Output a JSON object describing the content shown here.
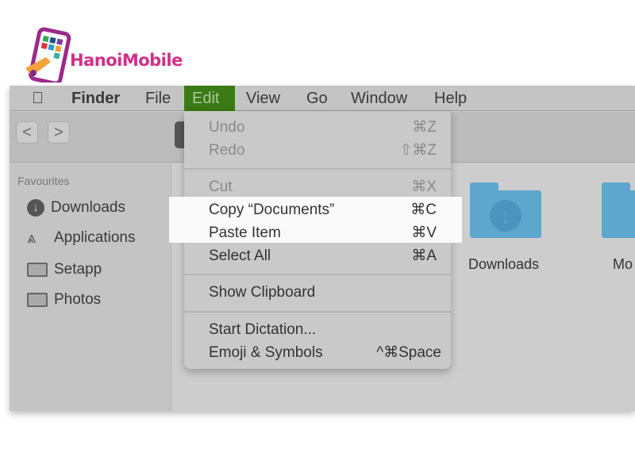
{
  "logo": {
    "text": "HanoiMobile"
  },
  "menubar": {
    "apple": "",
    "items": [
      "Finder",
      "File",
      "Edit",
      "View",
      "Go",
      "Window",
      "Help"
    ],
    "active": "Edit",
    "active_color": "#3b7a14"
  },
  "sidebar": {
    "heading": "Favourites",
    "items": [
      {
        "label": "Downloads",
        "icon": "download-circle-icon"
      },
      {
        "label": "Applications",
        "icon": "applications-icon"
      },
      {
        "label": "Setapp",
        "icon": "folder-icon"
      },
      {
        "label": "Photos",
        "icon": "folder-icon"
      }
    ]
  },
  "toolbar": {
    "back": "<",
    "forward": ">"
  },
  "edit_menu": {
    "items": [
      {
        "label": "Undo",
        "shortcut": "⌘Z",
        "enabled": false
      },
      {
        "label": "Redo",
        "shortcut": "⇧⌘Z",
        "enabled": false
      },
      {
        "label": "Cut",
        "shortcut": "⌘X",
        "enabled": false
      },
      {
        "label": "Copy “Documents”",
        "shortcut": "⌘C",
        "enabled": true,
        "highlighted": true
      },
      {
        "label": "Paste Item",
        "shortcut": "⌘V",
        "enabled": true,
        "highlighted": true
      },
      {
        "label": "Select All",
        "shortcut": "⌘A",
        "enabled": true
      },
      {
        "label": "Show Clipboard",
        "shortcut": "",
        "enabled": true
      },
      {
        "label": "Start Dictation...",
        "shortcut": "",
        "enabled": true
      },
      {
        "label": "Emoji & Symbols",
        "shortcut": "^⌘Space",
        "enabled": true
      }
    ]
  },
  "main": {
    "folders": [
      {
        "label": "Downloads"
      },
      {
        "label": "Mo"
      }
    ],
    "folder_color": "#5da7cf"
  }
}
